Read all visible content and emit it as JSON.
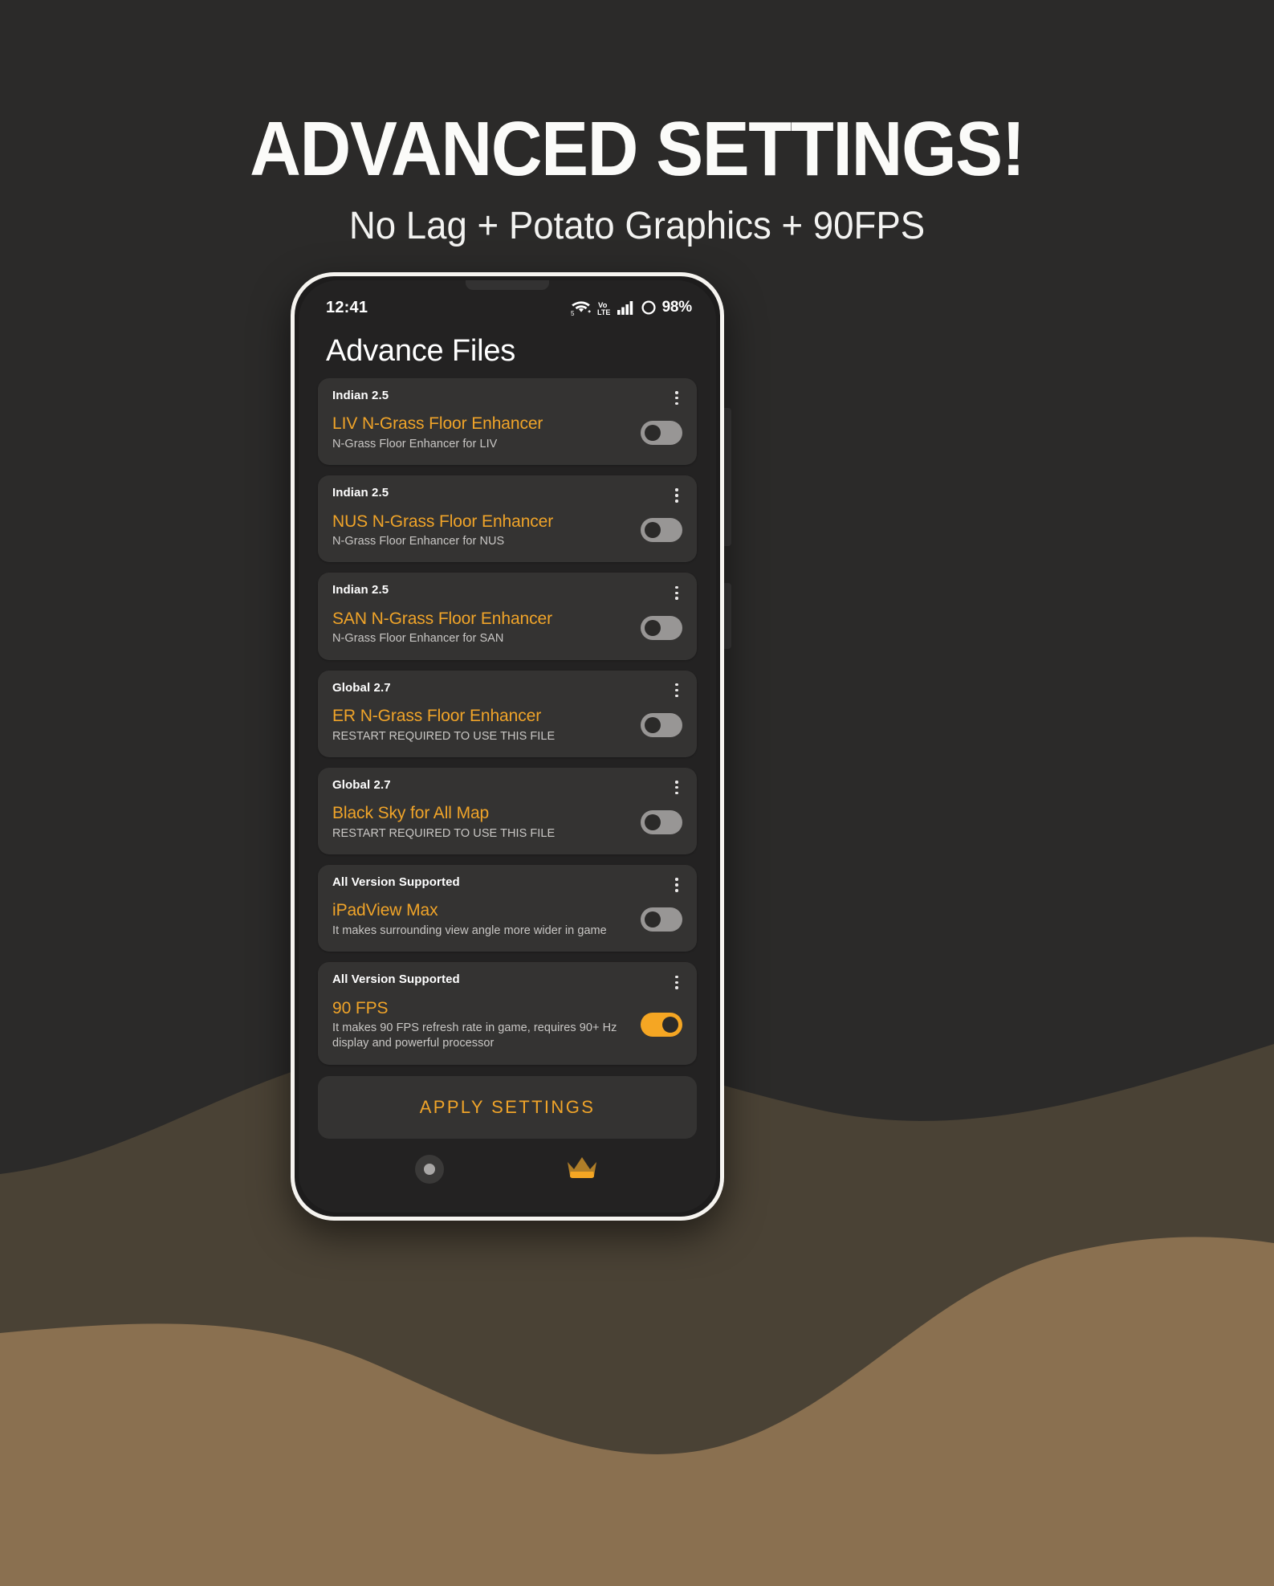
{
  "promo": {
    "title": "ADVANCED SETTINGS!",
    "subtitle": "No Lag + Potato Graphics + 90FPS"
  },
  "phone": {
    "status_bar": {
      "time": "12:41",
      "wifi_label": "5",
      "network_label_top": "Vo",
      "network_label_bottom": "LTE",
      "battery_percent": "98%",
      "icons": [
        "wifi-5-icon",
        "volte-icon",
        "signal-bars-icon",
        "battery-circle-icon"
      ]
    },
    "app_bar": {
      "title": "Advance Files"
    },
    "colors": {
      "accent": "#f0a429",
      "toggle_on": "#f5a623",
      "toggle_off": "#989695",
      "card_bg": "#343332",
      "screen_bg": "#232222",
      "page_bg": "#2b2a29",
      "wave_dark": "#4a4235",
      "wave_light": "#8a7050"
    },
    "file_cards": [
      {
        "version": "Indian 2.5",
        "name": "LIV N-Grass Floor Enhancer",
        "description": "N-Grass Floor Enhancer for LIV",
        "enabled": false,
        "menu_icon": "overflow-menu-icon"
      },
      {
        "version": "Indian 2.5",
        "name": "NUS N-Grass Floor Enhancer",
        "description": "N-Grass Floor Enhancer for NUS",
        "enabled": false,
        "menu_icon": "overflow-menu-icon"
      },
      {
        "version": "Indian 2.5",
        "name": "SAN N-Grass Floor Enhancer",
        "description": "N-Grass Floor Enhancer for SAN",
        "enabled": false,
        "menu_icon": "overflow-menu-icon"
      },
      {
        "version": "Global 2.7",
        "name": "ER N-Grass Floor Enhancer",
        "description": "RESTART REQUIRED TO USE THIS FILE",
        "enabled": false,
        "menu_icon": "overflow-menu-icon"
      },
      {
        "version": "Global 2.7",
        "name": "Black Sky for All Map",
        "description": "RESTART REQUIRED TO USE THIS FILE",
        "enabled": false,
        "menu_icon": "overflow-menu-icon"
      },
      {
        "version": "All Version Supported",
        "name": "iPadView Max",
        "description": "It makes surrounding view angle more wider in game",
        "enabled": false,
        "menu_icon": "overflow-menu-icon"
      },
      {
        "version": "All Version Supported",
        "name": "90 FPS",
        "description": "It makes 90 FPS refresh rate in game, requires 90+ Hz display and powerful processor",
        "enabled": true,
        "menu_icon": "overflow-menu-icon"
      }
    ],
    "apply_button": {
      "label": "APPLY SETTINGS"
    },
    "bottom_nav": [
      {
        "icon": "home-circle-icon",
        "label": ""
      },
      {
        "icon": "crown-premium-icon",
        "label": ""
      }
    ]
  }
}
